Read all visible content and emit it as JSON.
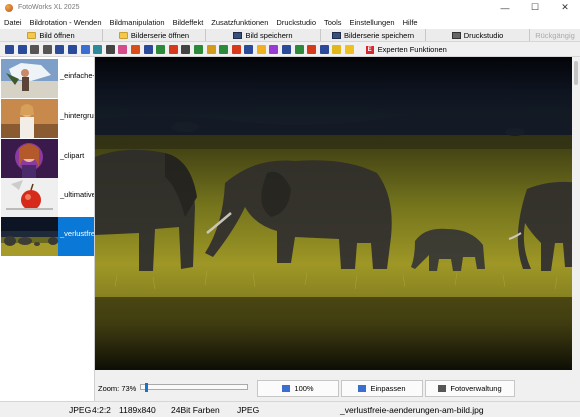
{
  "window": {
    "title": "FotoWorks XL 2025",
    "minimize": "—",
    "maximize": "☐",
    "close": "✕"
  },
  "menu": [
    "Datei",
    "Bildrotation - Wenden",
    "Bildmanipulation",
    "Bildeffekt",
    "Zusatzfunktionen",
    "Druckstudio",
    "Tools",
    "Einstellungen",
    "Hilfe"
  ],
  "buttons": {
    "open_image": "Bild öffnen",
    "open_series": "Bilderserie öffnen",
    "save_image": "Bild speichern",
    "save_series": "Bilderserie speichern",
    "print_studio": "Druckstudio",
    "undo": "Rückgängig"
  },
  "toolbar": {
    "icons": [
      "rotate-left-icon",
      "rotate-right-icon",
      "undo-icon",
      "redo-icon",
      "flip-horizontal-icon",
      "flip-vertical-icon",
      "crop-icon",
      "resize-icon",
      "tool-icon",
      "color-icon",
      "filter-icon",
      "picture-icon",
      "frame-icon",
      "draw-icon",
      "text-icon",
      "effect-icon",
      "brush-icon",
      "clone-icon",
      "eye-icon",
      "shape-icon",
      "star-icon",
      "sticker-icon",
      "light-icon",
      "collage-icon",
      "print-icon",
      "share-icon",
      "image-icon",
      "star2-icon"
    ],
    "icon_colors": [
      "#2c4a9a",
      "#2c4a9a",
      "#555555",
      "#555555",
      "#2c4a9a",
      "#2c4a9a",
      "#3a6ed0",
      "#2c8a9a",
      "#444444",
      "#d64b8c",
      "#d94d1a",
      "#2c4a9a",
      "#2c8a3a",
      "#d63a1a",
      "#444444",
      "#2a8a3a",
      "#d49a1a",
      "#2c8a3a",
      "#d63a1a",
      "#2c4a9a",
      "#f0b020",
      "#9a3ad6",
      "#2c4a9a",
      "#2c8a3a",
      "#d63a1a",
      "#2c4a9a",
      "#e0b81a",
      "#f0c020"
    ],
    "expert_badge": "E",
    "expert_label": "Experten Funktionen"
  },
  "thumbnails": [
    {
      "label": "_einfache-",
      "selected": false
    },
    {
      "label": "_hintergru",
      "selected": false
    },
    {
      "label": "_clipart",
      "selected": false
    },
    {
      "label": "_ultimative",
      "selected": false
    },
    {
      "label": "_verlustfrei",
      "selected": true
    }
  ],
  "controls": {
    "zoom_label": "Zoom: 73%",
    "zoom_percent": 73,
    "btn_100": "100%",
    "btn_fit": "Einpassen",
    "btn_manager": "Fotoverwaltung"
  },
  "status": {
    "format": "JPEG",
    "subsampling": "4:2:2",
    "dimensions": "1189x840",
    "colors": "24Bit Farben",
    "type": "JPEG",
    "filename": "_verlustfreie-aenderungen-am-bild.jpg"
  },
  "colors": {
    "selection": "#0a78d7",
    "expert_badge": "#d9262e"
  }
}
